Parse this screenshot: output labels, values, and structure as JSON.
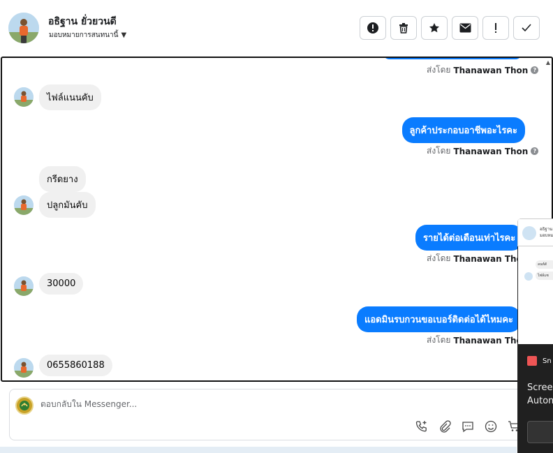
{
  "header": {
    "contact_name": "อธิฐาน ยั่วยวนดี",
    "assign_label": "มอบหมายการสนทนานี้"
  },
  "toolbar": {
    "buttons": [
      {
        "name": "alert-circle-icon"
      },
      {
        "name": "trash-icon"
      },
      {
        "name": "star-icon"
      },
      {
        "name": "envelope-icon"
      },
      {
        "name": "exclamation-icon"
      },
      {
        "name": "check-icon"
      }
    ]
  },
  "chat": {
    "sent_by_prefix": "ส่งโดย",
    "agent_name": "Thanawan Thon",
    "messages": [
      {
        "dir": "in",
        "text": "ไฟล์แนนคับ"
      },
      {
        "dir": "out",
        "text": "ลูกค้าประกอบอาชีพอะไรคะ"
      },
      {
        "dir": "in",
        "text": "กรีดยาง"
      },
      {
        "dir": "in",
        "text": "ปลูกมันคับ"
      },
      {
        "dir": "out",
        "text": "รายได้ต่อเดือนเท่าไรคะ"
      },
      {
        "dir": "in",
        "text": "30000"
      },
      {
        "dir": "out",
        "text": "แอดมินรบกวนขอเบอร์ติดต่อได้ไหมคะ"
      },
      {
        "dir": "in",
        "text": "0655860188"
      }
    ]
  },
  "composer": {
    "placeholder": "ตอบกลับใน Messenger..."
  },
  "overlay": {
    "mini_header": "อธิฐาน ยั่วยวนดี",
    "mini_sub": "มอบหมายการสนทนานี้",
    "mini_msg1": "ลนห์สั",
    "mini_msg2": "ไฟล์แซ",
    "app_label": "Sn",
    "title_line1": "Screen",
    "title_line2": "Autom"
  },
  "colors": {
    "outgoing_bubble": "#0a7cff",
    "incoming_bubble": "#f0f0f0"
  }
}
